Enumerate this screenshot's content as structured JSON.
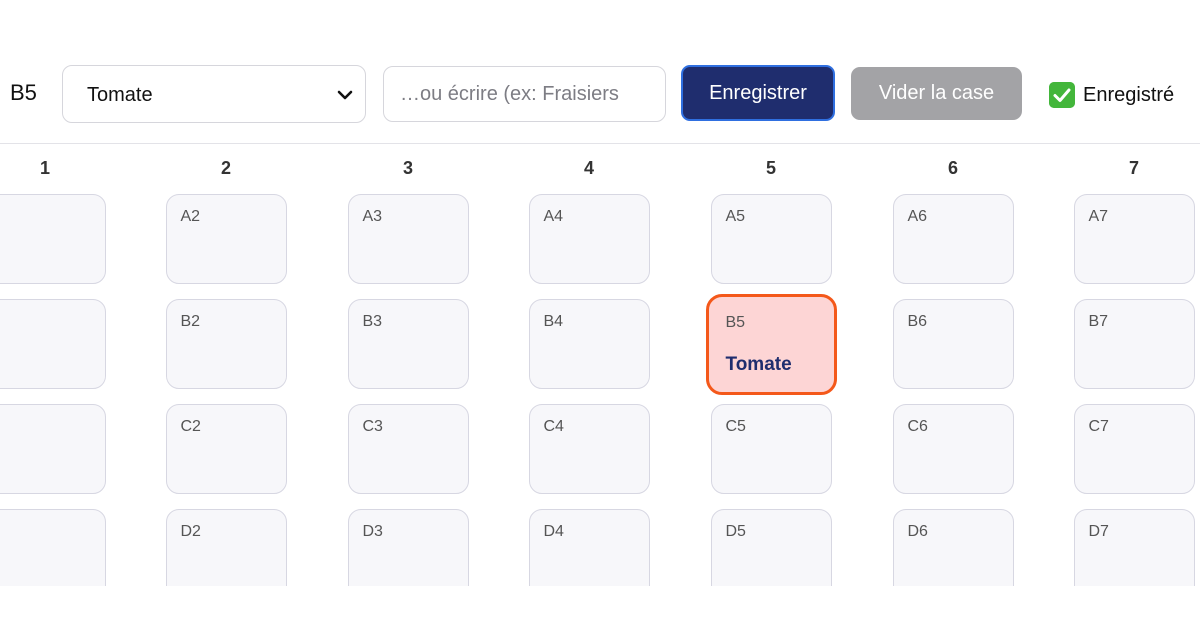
{
  "toolbar": {
    "selected_cell": "B5",
    "plant_select_value": "Tomate",
    "custom_input_placeholder": "…ou écrire (ex: Fraisiers",
    "save_label": "Enregistrer",
    "clear_label": "Vider la case",
    "status_text": "Enregistré",
    "status_icon": "checkbox-checked-icon"
  },
  "colors": {
    "primary": "#1f2d6e",
    "primary_border": "#2f6fe0",
    "disabled": "#a3a3a6",
    "selected_fill": "#fdd5d5",
    "selected_border": "#f4581a",
    "status_green": "#43b63b"
  },
  "grid": {
    "columns": [
      "1",
      "2",
      "3",
      "4",
      "5",
      "6",
      "7"
    ],
    "rows": [
      {
        "row": "A",
        "cells": [
          {
            "id": "",
            "plant": ""
          },
          {
            "id": "A2",
            "plant": ""
          },
          {
            "id": "A3",
            "plant": ""
          },
          {
            "id": "A4",
            "plant": ""
          },
          {
            "id": "A5",
            "plant": ""
          },
          {
            "id": "A6",
            "plant": ""
          },
          {
            "id": "A7",
            "plant": ""
          }
        ]
      },
      {
        "row": "B",
        "cells": [
          {
            "id": "",
            "plant": ""
          },
          {
            "id": "B2",
            "plant": ""
          },
          {
            "id": "B3",
            "plant": ""
          },
          {
            "id": "B4",
            "plant": ""
          },
          {
            "id": "B5",
            "plant": "Tomate",
            "selected": true
          },
          {
            "id": "B6",
            "plant": ""
          },
          {
            "id": "B7",
            "plant": ""
          }
        ]
      },
      {
        "row": "C",
        "cells": [
          {
            "id": "",
            "plant": ""
          },
          {
            "id": "C2",
            "plant": ""
          },
          {
            "id": "C3",
            "plant": ""
          },
          {
            "id": "C4",
            "plant": ""
          },
          {
            "id": "C5",
            "plant": ""
          },
          {
            "id": "C6",
            "plant": ""
          },
          {
            "id": "C7",
            "plant": ""
          }
        ]
      },
      {
        "row": "D",
        "cells": [
          {
            "id": "",
            "plant": ""
          },
          {
            "id": "D2",
            "plant": ""
          },
          {
            "id": "D3",
            "plant": ""
          },
          {
            "id": "D4",
            "plant": ""
          },
          {
            "id": "D5",
            "plant": ""
          },
          {
            "id": "D6",
            "plant": ""
          },
          {
            "id": "D7",
            "plant": ""
          }
        ]
      }
    ]
  }
}
